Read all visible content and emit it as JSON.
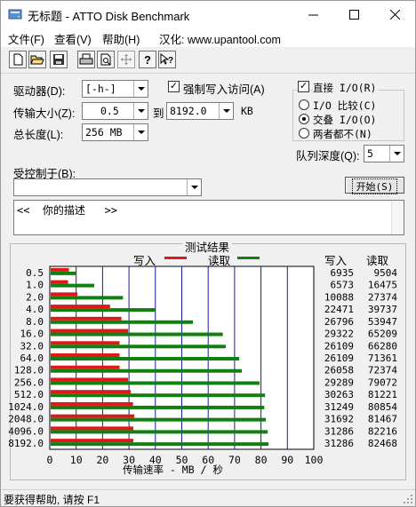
{
  "window": {
    "title": "无标题 - ATTO Disk Benchmark"
  },
  "menu": [
    "文件(F)",
    "查看(V)",
    "帮助(H)",
    "汉化: www.upantool.com"
  ],
  "toolbar": [
    "new-icon",
    "open-icon",
    "save-icon",
    "print-icon",
    "print-preview-icon",
    "move-icon",
    "help-icon",
    "context-help-icon"
  ],
  "settings": {
    "drive_label": "驱动器(D):",
    "drive_value": "[-h-]",
    "transfer_label": "传输大小(Z):",
    "transfer_from": "0.5",
    "transfer_to_label": "到",
    "transfer_to": "8192.0",
    "transfer_unit": "KB",
    "length_label": "总长度(L):",
    "length_value": "256 MB",
    "force_write_label": "强制写入访问(A)",
    "direct_io_label": "直接 I/O(R)",
    "io_compare_label": "I/O 比较(C)",
    "overlapped_io_label": "交叠 I/O(O)",
    "neither_label": "两者都不(N)",
    "queue_label": "队列深度(Q):",
    "queue_value": "5",
    "controlled_by_label": "受控制于(B):",
    "controlled_by_value": "",
    "start_label": "开始(S)",
    "description": "<<  你的描述   >>"
  },
  "results": {
    "title": "测试结果",
    "legend_write": "写入",
    "legend_read": "读取",
    "col_write": "写入",
    "col_read": "读取",
    "x_axis_label": "传输速率 - MB / 秒",
    "x_ticks": [
      "0",
      "10",
      "20",
      "30",
      "40",
      "50",
      "60",
      "70",
      "80",
      "90",
      "100"
    ]
  },
  "chart_data": {
    "type": "bar",
    "orientation": "horizontal",
    "categories": [
      "0.5",
      "1.0",
      "2.0",
      "4.0",
      "8.0",
      "16.0",
      "32.0",
      "64.0",
      "128.0",
      "256.0",
      "512.0",
      "1024.0",
      "2048.0",
      "4096.0",
      "8192.0"
    ],
    "series": [
      {
        "name": "写入",
        "color": "#e01818",
        "values": [
          6.9,
          6.6,
          10.1,
          22.5,
          26.8,
          29.3,
          26.1,
          26.1,
          26.1,
          29.3,
          30.3,
          31.2,
          31.7,
          31.3,
          31.3
        ]
      },
      {
        "name": "读取",
        "color": "#118011",
        "values": [
          9.5,
          16.5,
          27.4,
          39.7,
          53.9,
          65.2,
          66.3,
          71.4,
          72.4,
          79.1,
          81.2,
          80.9,
          81.5,
          82.2,
          82.5
        ]
      }
    ],
    "table_write": [
      "6935",
      "6573",
      "10088",
      "22471",
      "26796",
      "29322",
      "26109",
      "26109",
      "26058",
      "29289",
      "30263",
      "31249",
      "31692",
      "31286",
      "31286"
    ],
    "table_read": [
      "9504",
      "16475",
      "27374",
      "39737",
      "53947",
      "65209",
      "66280",
      "71361",
      "72374",
      "79072",
      "81221",
      "80854",
      "81467",
      "82216",
      "82468"
    ],
    "xlim": [
      0,
      100
    ],
    "xlabel": "传输速率 - MB / 秒"
  },
  "status": "要获得帮助, 请按 F1"
}
